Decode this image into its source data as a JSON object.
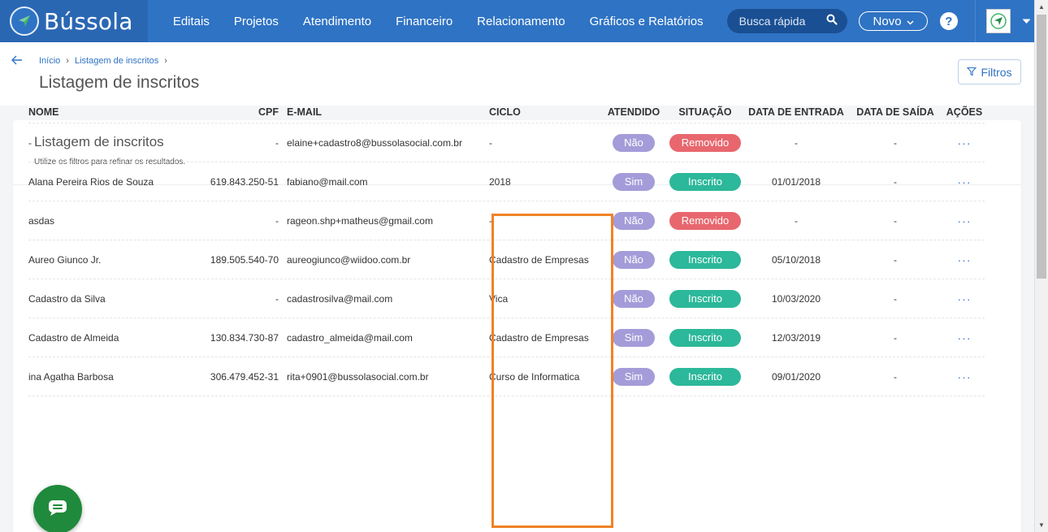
{
  "app": {
    "logo_text": "Bússola",
    "nav": [
      "Editais",
      "Projetos",
      "Atendimento",
      "Financeiro",
      "Relacionamento",
      "Gráficos e Relatórios"
    ],
    "search_placeholder": "Busca rápida",
    "novo_label": "Novo",
    "help_label": "?"
  },
  "breadcrumb": {
    "home": "Início",
    "current": "Listagem de inscritos",
    "sep": "›"
  },
  "page": {
    "title": "Listagem de inscritos",
    "filters_label": "Filtros"
  },
  "card": {
    "title": "Listagem de inscritos",
    "subtitle": "Utilize os filtros para refinar os resultados."
  },
  "table": {
    "headers": {
      "nome": "NOME",
      "cpf": "CPF",
      "email": "E-MAIL",
      "ciclo": "CICLO",
      "atendido": "ATENDIDO",
      "situacao": "SITUAÇÃO",
      "entrada": "DATA DE ENTRADA",
      "saida": "DATA DE SAÍDA",
      "acoes": "AÇÕES"
    },
    "rows": [
      {
        "nome": "-",
        "cpf": "-",
        "email": "elaine+cadastro8@bussolasocial.com.br",
        "ciclo": "-",
        "atendido": "Não",
        "situacao": "Removido",
        "entrada": "-",
        "saida": "-",
        "acoes": "···"
      },
      {
        "nome": "Alana Pereira Rios de Souza",
        "cpf": "619.843.250-51",
        "email": "fabiano@mail.com",
        "ciclo": "2018",
        "atendido": "Sim",
        "situacao": "Inscrito",
        "entrada": "01/01/2018",
        "saida": "-",
        "acoes": "···"
      },
      {
        "nome": "asdas",
        "cpf": "-",
        "email": "rageon.shp+matheus@gmail.com",
        "ciclo": "-",
        "atendido": "Não",
        "situacao": "Removido",
        "entrada": "-",
        "saida": "-",
        "acoes": "···"
      },
      {
        "nome": "Aureo Giunco Jr.",
        "cpf": "189.505.540-70",
        "email": "aureogiunco@wiidoo.com.br",
        "ciclo": "Cadastro de Empresas",
        "atendido": "Não",
        "situacao": "Inscrito",
        "entrada": "05/10/2018",
        "saida": "-",
        "acoes": "···"
      },
      {
        "nome": "Cadastro da Silva",
        "cpf": "-",
        "email": "cadastrosilva@mail.com",
        "ciclo": "Vica",
        "atendido": "Não",
        "situacao": "Inscrito",
        "entrada": "10/03/2020",
        "saida": "-",
        "acoes": "···"
      },
      {
        "nome": "Cadastro de Almeida",
        "cpf": "130.834.730-87",
        "email": "cadastro_almeida@mail.com",
        "ciclo": "Cadastro de Empresas",
        "atendido": "Sim",
        "situacao": "Inscrito",
        "entrada": "12/03/2019",
        "saida": "-",
        "acoes": "···"
      },
      {
        "nome": "ina Agatha Barbosa",
        "cpf": "306.479.452-31",
        "email": "rita+0901@bussolasocial.com.br",
        "ciclo": "Curso de Informatica",
        "atendido": "Sim",
        "situacao": "Inscrito",
        "entrada": "09/01/2020",
        "saida": "-",
        "acoes": "···"
      }
    ]
  },
  "colors": {
    "brand": "#2f73c4",
    "removido": "#e8676e",
    "inscrito": "#2cb89a",
    "atendido_pill": "#a49cd9",
    "highlight": "#f08227",
    "chat": "#1f8a3b"
  }
}
